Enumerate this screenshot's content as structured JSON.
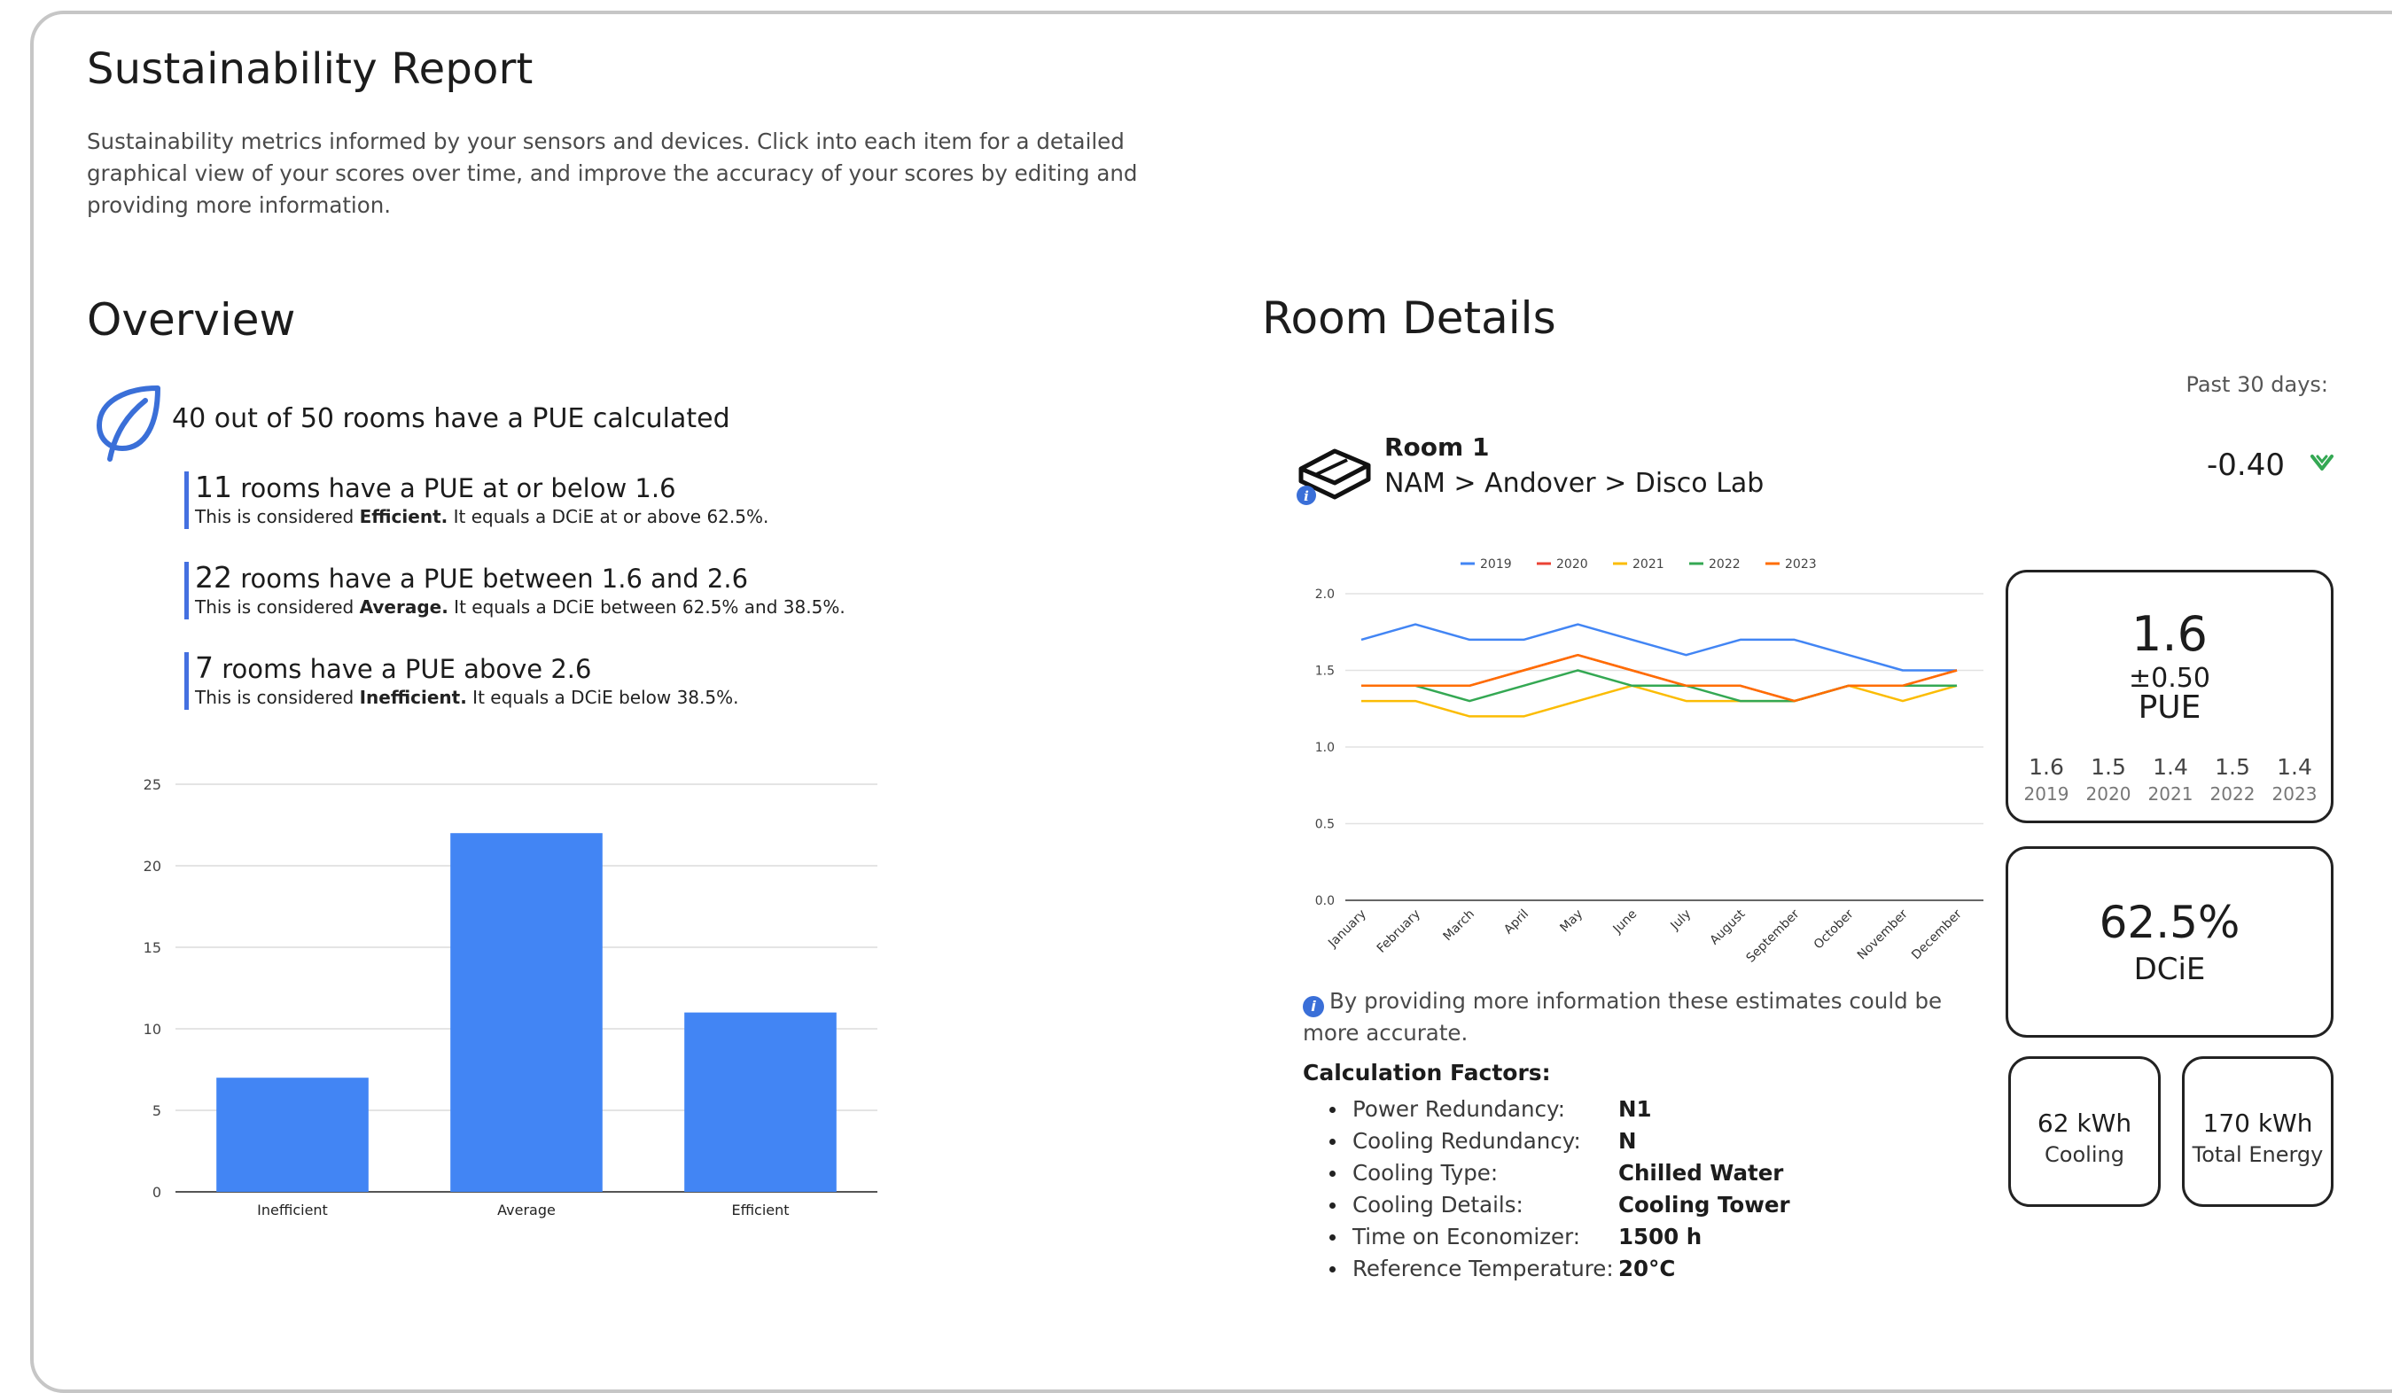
{
  "report": {
    "title": "Sustainability Report",
    "description": "Sustainability metrics informed by your sensors and devices.  Click into each item for a detailed graphical view of your scores over time, and improve the accuracy of your scores by editing and providing more information."
  },
  "overview": {
    "heading": "Overview",
    "summary": "40 out of 50 rooms have a PUE calculated",
    "buckets": [
      {
        "count": "11",
        "text": " rooms have a PUE at or below 1.6",
        "detail_pre": "This is considered ",
        "rating": "Efficient.",
        "detail_post": " It equals a DCiE at or above 62.5%."
      },
      {
        "count": "22",
        "text": " rooms have a PUE between 1.6 and 2.6",
        "detail_pre": "This is considered ",
        "rating": "Average.",
        "detail_post": "  It equals a DCiE between 62.5% and 38.5%."
      },
      {
        "count": "7",
        "text": " rooms have a PUE above 2.6",
        "detail_pre": "This is considered ",
        "rating": "Inefficient.",
        "detail_post": " It equals a DCiE below 38.5%."
      }
    ]
  },
  "room_details": {
    "heading": "Room Details",
    "period": "Past 30 days:",
    "room_name": "Room 1",
    "room_path": "NAM > Andover > Disco Lab",
    "delta": "-0.40",
    "pue_tile": {
      "value": "1.6",
      "plusminus": "±0.50",
      "label": "PUE",
      "years": [
        {
          "v": "1.6",
          "y": "2019"
        },
        {
          "v": "1.5",
          "y": "2020"
        },
        {
          "v": "1.4",
          "y": "2021"
        },
        {
          "v": "1.5",
          "y": "2022"
        },
        {
          "v": "1.4",
          "y": "2023"
        }
      ]
    },
    "dcie_tile": {
      "value": "62.5%",
      "label": "DCiE"
    },
    "cooling_tile": {
      "value": "62 kWh",
      "label": "Cooling"
    },
    "total_tile": {
      "value": "170 kWh",
      "label": "Total Energy"
    },
    "note": "By providing more information these estimates could be more accurate.",
    "calc_heading": "Calculation Factors:",
    "calc_factors": [
      {
        "k": "Power Redundancy:",
        "v": "N1"
      },
      {
        "k": "Cooling Redundancy:",
        "v": "N"
      },
      {
        "k": "Cooling Type:",
        "v": "Chilled Water"
      },
      {
        "k": "Cooling Details:",
        "v": "Cooling Tower"
      },
      {
        "k": "Time on Economizer:",
        "v": "1500 h"
      },
      {
        "k": "Reference Temperature:",
        "v": "20°C"
      }
    ],
    "icon_colors": {
      "accent": "#3a6fd8",
      "trend_down": "#34a853"
    }
  },
  "chart_data": [
    {
      "type": "bar",
      "title": "",
      "categories": [
        "Inefficient",
        "Average",
        "Efficient"
      ],
      "values": [
        7,
        22,
        11
      ],
      "ylim": [
        0,
        25
      ],
      "yticks": [
        0,
        5,
        10,
        15,
        20,
        25
      ],
      "color": "#4285f4",
      "grid": true
    },
    {
      "type": "line",
      "title": "",
      "legend_position": "top",
      "categories": [
        "January",
        "February",
        "March",
        "April",
        "May",
        "June",
        "July",
        "August",
        "September",
        "October",
        "November",
        "December"
      ],
      "ylim": [
        0,
        2.0
      ],
      "yticks": [
        "0.0",
        "0.5",
        "1.0",
        "1.5",
        "2.0"
      ],
      "grid": true,
      "series": [
        {
          "name": "2019",
          "color": "#4285f4",
          "values": [
            1.7,
            1.8,
            1.7,
            1.7,
            1.8,
            1.7,
            1.6,
            1.7,
            1.7,
            1.6,
            1.5,
            1.5
          ]
        },
        {
          "name": "2020",
          "color": "#ea4335",
          "values": [
            1.4,
            1.4,
            1.4,
            1.5,
            1.6,
            1.5,
            1.4,
            1.4,
            1.3,
            1.4,
            1.4,
            1.5
          ]
        },
        {
          "name": "2021",
          "color": "#fbbc04",
          "values": [
            1.3,
            1.3,
            1.2,
            1.2,
            1.3,
            1.4,
            1.3,
            1.3,
            1.3,
            1.4,
            1.3,
            1.4
          ]
        },
        {
          "name": "2022",
          "color": "#34a853",
          "values": [
            1.4,
            1.4,
            1.3,
            1.4,
            1.5,
            1.4,
            1.4,
            1.3,
            1.3,
            1.4,
            1.4,
            1.4
          ]
        },
        {
          "name": "2023",
          "color": "#ff6d01",
          "values": [
            1.4,
            1.4,
            1.4,
            1.5,
            1.6,
            1.5,
            1.4,
            1.4,
            1.3,
            1.4,
            1.4,
            1.5
          ]
        }
      ]
    }
  ]
}
